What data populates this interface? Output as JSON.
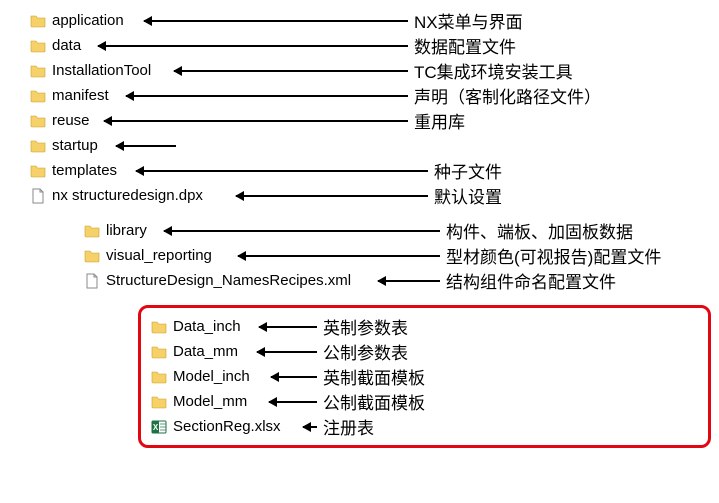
{
  "group1": [
    {
      "icon": "folder",
      "name": "application",
      "desc": "NX菜单与界面",
      "nameW": 82,
      "arrowW": 264
    },
    {
      "icon": "folder",
      "name": "data",
      "desc": "数据配置文件",
      "nameW": 36,
      "arrowW": 310
    },
    {
      "icon": "folder",
      "name": "InstallationTool",
      "desc": "TC集成环境安装工具",
      "nameW": 112,
      "arrowW": 234
    },
    {
      "icon": "folder",
      "name": "manifest",
      "desc": "声明（客制化路径文件）",
      "nameW": 64,
      "arrowW": 282
    },
    {
      "icon": "folder",
      "name": "reuse",
      "desc": "重用库",
      "nameW": 42,
      "arrowW": 304
    },
    {
      "icon": "folder",
      "name": "startup",
      "desc": "",
      "nameW": 54,
      "arrowW": 60
    },
    {
      "icon": "folder",
      "name": "templates",
      "desc": "种子文件",
      "nameW": 74,
      "arrowW": 292
    },
    {
      "icon": "file",
      "name": "nx  structuredesign.dpx",
      "desc": "默认设置",
      "nameW": 174,
      "arrowW": 192
    }
  ],
  "group2": [
    {
      "icon": "folder",
      "name": "library",
      "desc": "构件、端板、加固板数据",
      "nameW": 48,
      "arrowW": 276
    },
    {
      "icon": "folder",
      "name": "visual_reporting",
      "desc": "型材颜色(可视报告)配置文件",
      "nameW": 122,
      "arrowW": 202
    },
    {
      "icon": "file",
      "name": "StructureDesign_NamesRecipes.xml",
      "desc": "结构组件命名配置文件",
      "nameW": 262,
      "arrowW": 62
    }
  ],
  "group3": [
    {
      "icon": "folder",
      "name": "Data_inch",
      "desc": "英制参数表",
      "nameW": 76,
      "arrowW": 58
    },
    {
      "icon": "folder",
      "name": "Data_mm",
      "desc": "公制参数表",
      "nameW": 74,
      "arrowW": 60
    },
    {
      "icon": "folder",
      "name": "Model_inch",
      "desc": "英制截面模板",
      "nameW": 88,
      "arrowW": 46
    },
    {
      "icon": "folder",
      "name": "Model_mm",
      "desc": "公制截面模板",
      "nameW": 86,
      "arrowW": 48
    },
    {
      "icon": "excel",
      "name": "SectionReg.xlsx",
      "desc": "注册表",
      "nameW": 120,
      "arrowW": 14
    }
  ]
}
